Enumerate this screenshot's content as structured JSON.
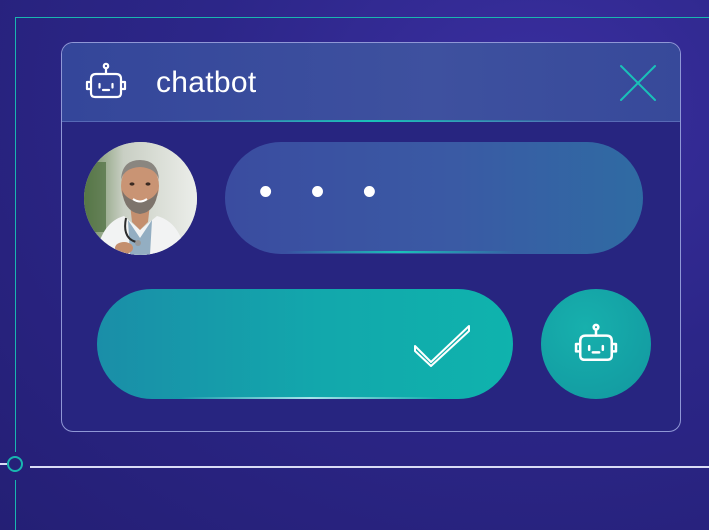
{
  "window": {
    "title": "chatbot",
    "header_icon": "robot-icon",
    "close_icon": "close-icon"
  },
  "conversation": {
    "avatar": "doctor-avatar",
    "typing_indicator": "• • •"
  },
  "actions": {
    "confirm_icon": "checkmark-icon",
    "bot_icon": "robot-icon"
  },
  "colors": {
    "background": "#2c2688",
    "accent_teal": "#19b6b0",
    "bubble_blue": "#3a4ca0",
    "text": "#ffffff"
  }
}
